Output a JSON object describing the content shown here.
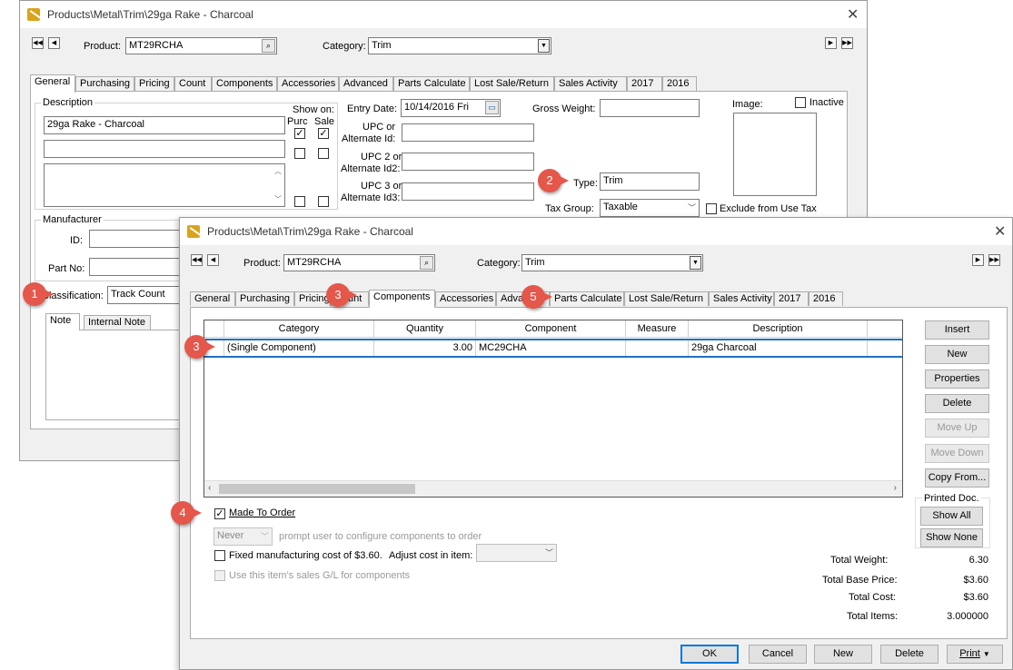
{
  "back_window": {
    "title": "Products\\Metal\\Trim\\29ga Rake - Charcoal",
    "product_label": "Product:",
    "product_value": "MT29RCHA",
    "category_label": "Category:",
    "category_value": "Trim",
    "tabs": [
      "General",
      "Purchasing",
      "Pricing",
      "Count",
      "Components",
      "Accessories",
      "Advanced",
      "Parts Calculate",
      "Lost Sale/Return",
      "Sales Activity",
      "2017",
      "2016"
    ],
    "description_label": "Description",
    "description_1": "29ga Rake - Charcoal",
    "show_on_label": "Show on:",
    "purc_label": "Purc",
    "sale_label": "Sale",
    "entry_date_label": "Entry Date:",
    "entry_date_value": "10/14/2016 Fri",
    "gross_weight_label": "Gross Weight:",
    "upc_label_1": "UPC or",
    "upc_label_2": "Alternate Id:",
    "upc2_label_1": "UPC 2 or",
    "upc2_label_2": "Alternate Id2:",
    "upc3_label_1": "UPC 3 or",
    "upc3_label_2": "Alternate Id3:",
    "type_label": "Type:",
    "type_value": "Trim",
    "tax_group_label": "Tax Group:",
    "tax_group_value": "Taxable",
    "exclude_label": "Exclude from Use Tax",
    "image_label": "Image:",
    "inactive_label": "Inactive",
    "manufacturer_label": "Manufacturer",
    "id_label": "ID:",
    "part_no_label": "Part No:",
    "classification_label": "Classification:",
    "classification_value": "Track Count",
    "note_tab": "Note",
    "internal_note_tab": "Internal Note"
  },
  "front_window": {
    "title": "Products\\Metal\\Trim\\29ga Rake - Charcoal",
    "product_label": "Product:",
    "product_value": "MT29RCHA",
    "category_label": "Category:",
    "category_value": "Trim",
    "tabs": [
      "General",
      "Purchasing",
      "Pricing",
      "Count",
      "Components",
      "Accessories",
      "Advanced",
      "Parts Calculate",
      "Lost Sale/Return",
      "Sales Activity",
      "2017",
      "2016"
    ],
    "grid_headers": [
      "Category",
      "Quantity",
      "Component",
      "Measure",
      "Description"
    ],
    "grid_rows": [
      {
        "category": "(Single Component)",
        "quantity": "3.00",
        "component": "MC29CHA",
        "measure": "",
        "description": "29ga Charcoal"
      }
    ],
    "side_buttons": [
      "Insert",
      "New",
      "Properties",
      "Delete",
      "Move Up",
      "Move Down",
      "Copy From..."
    ],
    "printed_doc_label": "Printed Doc.",
    "show_all": "Show All",
    "show_none": "Show None",
    "made_to_order_label": "Made To Order",
    "never_value": "Never",
    "prompt_text": "prompt user to configure components to order",
    "fixed_cost_label": "Fixed manufacturing cost of $3.60.",
    "adjust_cost_label": "Adjust cost in item:",
    "use_gl_label": "Use this item's sales G/L for components",
    "totals": [
      {
        "label": "Total Weight:",
        "value": "6.30"
      },
      {
        "label": "Total Base Price:",
        "value": "$3.60"
      },
      {
        "label": "Total Cost:",
        "value": "$3.60"
      },
      {
        "label": "Total Items:",
        "value": "3.000000"
      }
    ],
    "bottom_buttons": [
      "OK",
      "Cancel",
      "New",
      "Delete",
      "Print"
    ]
  },
  "callouts": [
    "1",
    "2",
    "3",
    "3",
    "4",
    "5"
  ]
}
